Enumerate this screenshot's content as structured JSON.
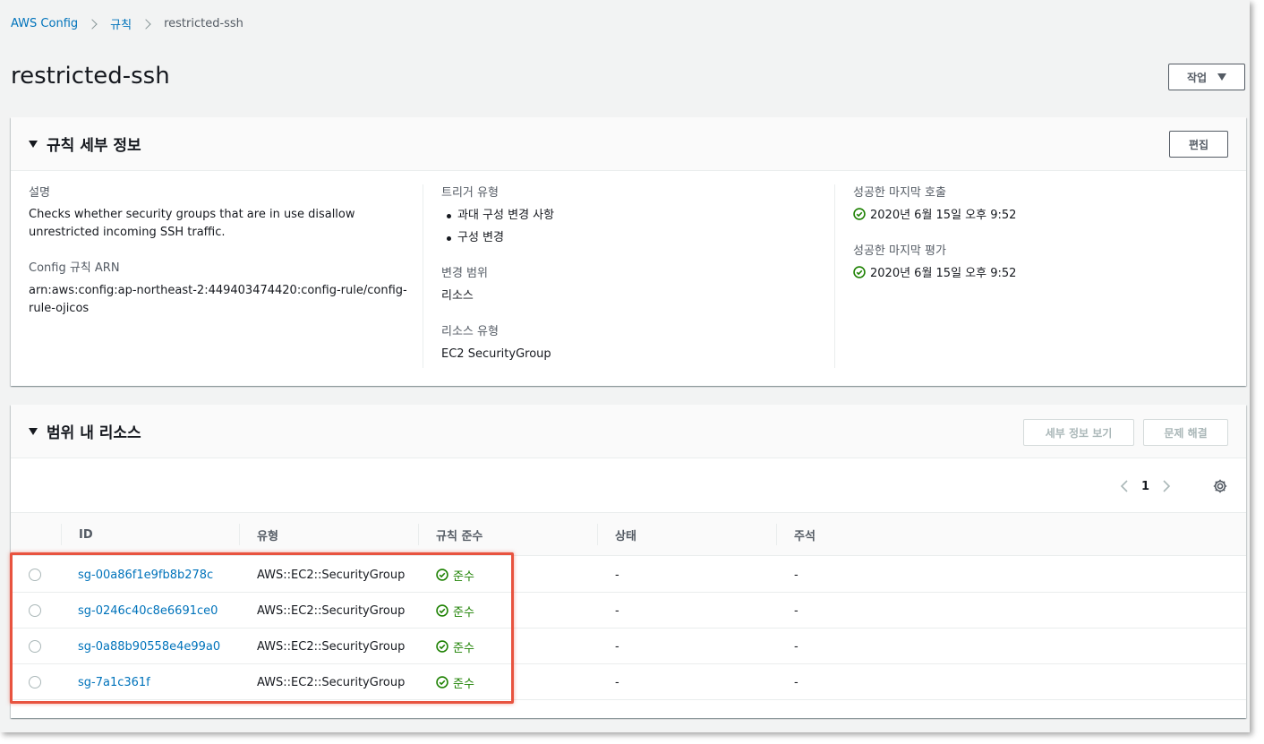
{
  "breadcrumb": {
    "root": "AWS Config",
    "rules": "규칙",
    "current": "restricted-ssh"
  },
  "page": {
    "title": "restricted-ssh",
    "actions_label": "작업"
  },
  "details": {
    "title": "규칙 세부 정보",
    "edit_label": "편집",
    "description_label": "설명",
    "description": "Checks whether security groups that are in use disallow unrestricted incoming SSH traffic.",
    "arn_label": "Config 규칙 ARN",
    "arn": "arn:aws:config:ap-northeast-2:449403474420:config-rule/config-rule-ojicos",
    "trigger_label": "트리거 유형",
    "triggers": [
      "과대 구성 변경 사항",
      "구성 변경"
    ],
    "scope_label": "변경 범위",
    "scope": "리소스",
    "resource_type_label": "리소스 유형",
    "resource_type": "EC2 SecurityGroup",
    "last_invocation_label": "성공한 마지막 호출",
    "last_invocation": "2020년 6월 15일 오후 9:52",
    "last_evaluation_label": "성공한 마지막 평가",
    "last_evaluation": "2020년 6월 15일 오후 9:52"
  },
  "resources": {
    "title": "범위 내 리소스",
    "view_details_label": "세부 정보 보기",
    "troubleshoot_label": "문제 해결",
    "page": "1",
    "columns": [
      "ID",
      "유형",
      "규칙 준수",
      "상태",
      "주석"
    ],
    "rows": [
      {
        "id": "sg-00a86f1e9fb8b278c",
        "type": "AWS::EC2::SecurityGroup",
        "compliance": "준수",
        "status": "-",
        "note": "-"
      },
      {
        "id": "sg-0246c40c8e6691ce0",
        "type": "AWS::EC2::SecurityGroup",
        "compliance": "준수",
        "status": "-",
        "note": "-"
      },
      {
        "id": "sg-0a88b90558e4e99a0",
        "type": "AWS::EC2::SecurityGroup",
        "compliance": "준수",
        "status": "-",
        "note": "-"
      },
      {
        "id": "sg-7a1c361f",
        "type": "AWS::EC2::SecurityGroup",
        "compliance": "준수",
        "status": "-",
        "note": "-"
      }
    ]
  },
  "colors": {
    "link": "#0073bb",
    "success": "#1d8102",
    "highlight": "#e8533f"
  }
}
